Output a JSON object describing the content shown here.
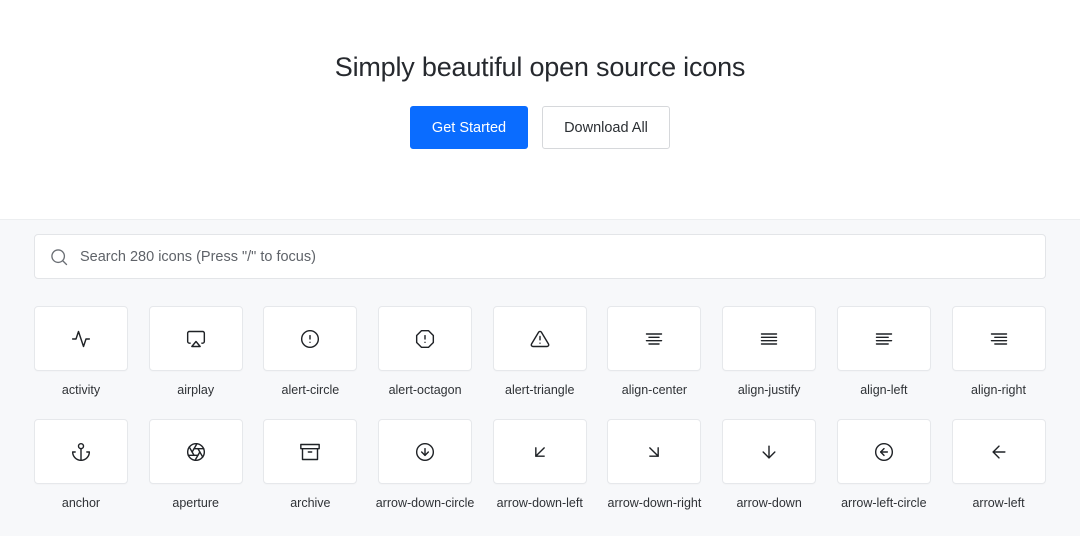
{
  "hero": {
    "title": "Simply beautiful open source icons",
    "get_started_label": "Get Started",
    "download_all_label": "Download All",
    "primary_color": "#0a6cff"
  },
  "search": {
    "placeholder": "Search 280 icons (Press \"/\" to focus)",
    "value": ""
  },
  "icons": [
    {
      "name": "activity",
      "label": "activity"
    },
    {
      "name": "airplay",
      "label": "airplay"
    },
    {
      "name": "alert-circle",
      "label": "alert-circle"
    },
    {
      "name": "alert-octagon",
      "label": "alert-octagon"
    },
    {
      "name": "alert-triangle",
      "label": "alert-triangle"
    },
    {
      "name": "align-center",
      "label": "align-center"
    },
    {
      "name": "align-justify",
      "label": "align-justify"
    },
    {
      "name": "align-left",
      "label": "align-left"
    },
    {
      "name": "align-right",
      "label": "align-right"
    },
    {
      "name": "anchor",
      "label": "anchor"
    },
    {
      "name": "aperture",
      "label": "aperture"
    },
    {
      "name": "archive",
      "label": "archive"
    },
    {
      "name": "arrow-down-circle",
      "label": "arrow-down-circle"
    },
    {
      "name": "arrow-down-left",
      "label": "arrow-down-left"
    },
    {
      "name": "arrow-down-right",
      "label": "arrow-down-right"
    },
    {
      "name": "arrow-down",
      "label": "arrow-down"
    },
    {
      "name": "arrow-left-circle",
      "label": "arrow-left-circle"
    },
    {
      "name": "arrow-left",
      "label": "arrow-left"
    }
  ]
}
